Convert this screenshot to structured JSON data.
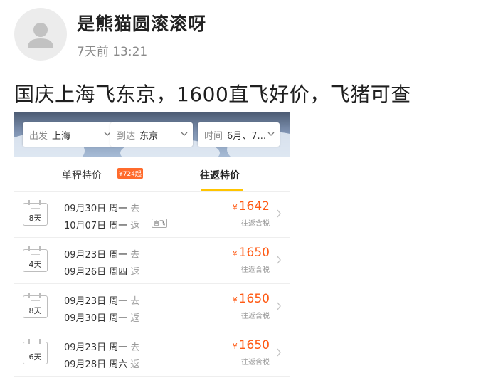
{
  "post": {
    "username": "是熊猫圆滚滚呀",
    "time": "7天前 13:21",
    "text": "国庆上海飞东京，1600直飞好价，飞猪可查"
  },
  "search": {
    "from_key": "出发",
    "from_value": "上海",
    "to_key": "到达",
    "to_value": "东京",
    "time_key": "时间",
    "time_value": "6月、7..."
  },
  "tabs": {
    "oneway_label": "单程特价",
    "oneway_badge": "¥724起",
    "roundtrip_label": "往返特价",
    "active": "往返特价"
  },
  "flights": [
    {
      "days": "8天",
      "out_date": "09月30日 周一",
      "out_tag": "去",
      "ret_date": "10月07日 周一",
      "ret_tag": "返",
      "direct": "直飞",
      "currency": "¥",
      "price": "1642",
      "note": "往返含税"
    },
    {
      "days": "4天",
      "out_date": "09月23日 周一",
      "out_tag": "去",
      "ret_date": "09月26日 周四",
      "ret_tag": "返",
      "currency": "¥",
      "price": "1650",
      "note": "往返含税"
    },
    {
      "days": "8天",
      "out_date": "09月23日 周一",
      "out_tag": "去",
      "ret_date": "09月30日 周一",
      "ret_tag": "返",
      "currency": "¥",
      "price": "1650",
      "note": "往返含税"
    },
    {
      "days": "6天",
      "out_date": "09月23日 周一",
      "out_tag": "去",
      "ret_date": "09月28日 周六",
      "ret_tag": "返",
      "currency": "¥",
      "price": "1650",
      "note": "往返含税"
    }
  ],
  "colors": {
    "accent_price": "#ff5a14",
    "tab_underline": "#ffc400",
    "badge": "#ff6b2c"
  }
}
